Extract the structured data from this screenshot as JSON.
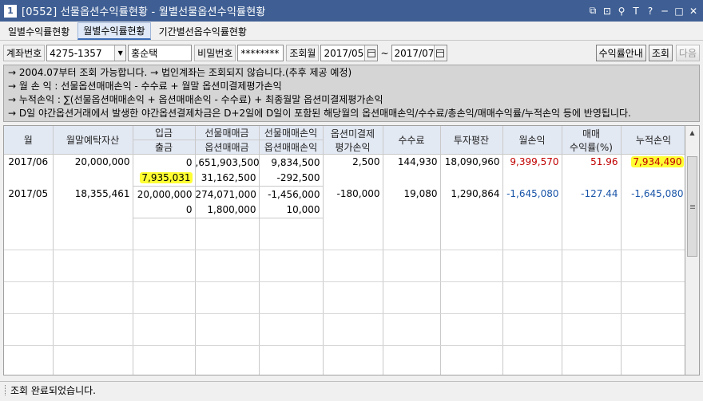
{
  "window": {
    "number": "1",
    "title": "[0552] 선물옵션수익률현황 - 월별선물옵션수익률현황",
    "controls": [
      "⧉",
      "⊡",
      "⚲",
      "T",
      "?",
      "─",
      "□",
      "✕"
    ]
  },
  "tabs": [
    {
      "label": "일별수익률현황"
    },
    {
      "label": "월별수익률현황"
    },
    {
      "label": "기간별선옵수익률현황"
    }
  ],
  "query": {
    "account_label": "계좌번호",
    "account_value": "4275-1357",
    "owner_name": "홍순택",
    "password_label": "비밀번호",
    "password_value": "********",
    "month_label": "조회월",
    "from_month": "2017/05",
    "range_sep": "~",
    "to_month": "2017/07",
    "guide_button": "수익률안내",
    "search_button": "조회",
    "next_button": "다음"
  },
  "info_lines": [
    "→ 2004.07부터 조회 가능합니다. → 법인계좌는 조회되지 않습니다.(추후 제공 예정)",
    "→ 월 손 익 : 선물옵션매매손익 - 수수료 + 월말 옵션미결제평가손익",
    "→ 누적손익 : ∑(선물옵션매매손익 + 옵션매매손익 - 수수료) + 최종월말 옵션미결제평가손익",
    "→ D일 야간옵션거래에서 발생한 야간옵션결제차금은 D+2일에 D일이 포함된 해당월의 옵션매매손익/수수료/총손익/매매수익률/누적손익 등에 반영됩니다."
  ],
  "grid": {
    "headers": {
      "month": "월",
      "deposit_assets": "월말예탁자산",
      "in_top": "입금",
      "in_bottom": "출금",
      "fut_trade_top": "선물매매금",
      "fut_trade_bottom": "옵션매매금",
      "fut_pl_top": "선물매매손익",
      "fut_pl_bottom": "옵션매매손익",
      "opt_eval_top": "옵션미결제",
      "opt_eval_bottom": "평가손익",
      "fee": "수수료",
      "avg_invest": "투자평잔",
      "month_pl": "월손익",
      "yield_top": "매매",
      "yield_bottom": "수익률(%)",
      "cum_pl": "누적손익"
    },
    "rows": [
      {
        "month": "2017/06",
        "deposit_assets": "20,000,000",
        "deposit_in": "0",
        "withdraw": "7,935,031",
        "fut_trade": ",651,903,500",
        "opt_trade": "31,162,500",
        "fut_pl": "9,834,500",
        "opt_pl": "-292,500",
        "opt_eval": "2,500",
        "fee": "144,930",
        "avg_invest": "18,090,960",
        "month_pl": "9,399,570",
        "yield": "51.96",
        "cum_pl": "7,934,490"
      },
      {
        "month": "2017/05",
        "deposit_assets": "18,355,461",
        "deposit_in": "20,000,000",
        "withdraw": "0",
        "fut_trade": "274,071,000",
        "opt_trade": "1,800,000",
        "fut_pl": "-1,456,000",
        "opt_pl": "10,000",
        "opt_eval": "-180,000",
        "fee": "19,080",
        "avg_invest": "1,290,864",
        "month_pl": "-1,645,080",
        "yield": "-127.44",
        "cum_pl": "-1,645,080"
      }
    ],
    "colors": {
      "positive": "#c00000",
      "negative": "#1a55a8",
      "highlight": "#ffff33"
    }
  },
  "status": {
    "message": "조회 완료되었습니다."
  }
}
